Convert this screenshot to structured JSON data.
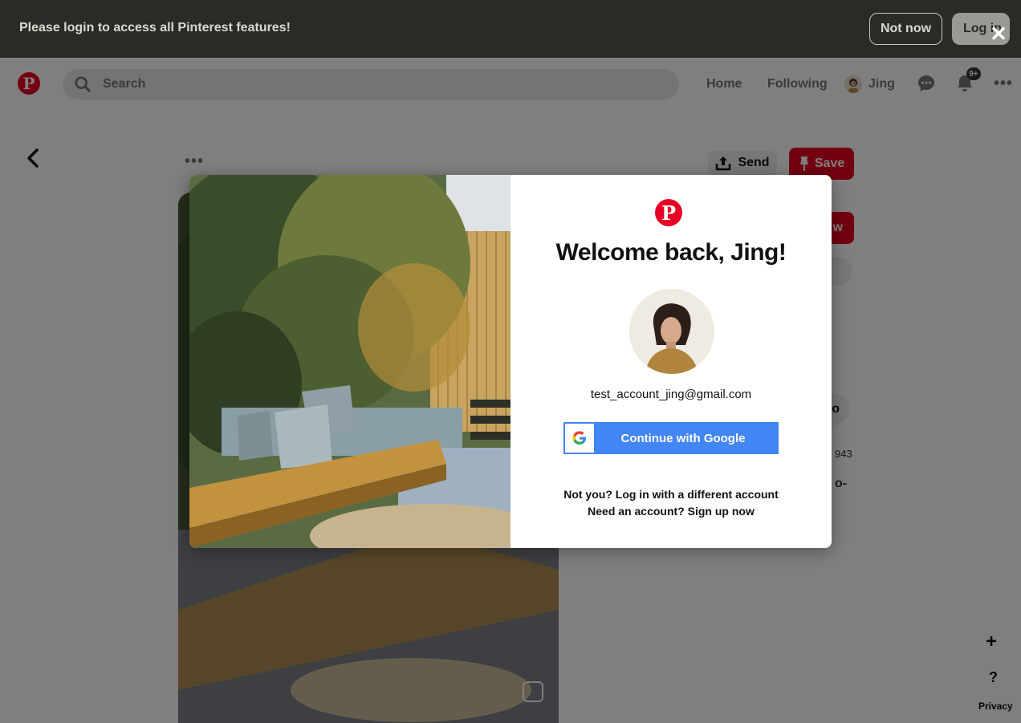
{
  "banner": {
    "message": "Please login to access all Pinterest features!",
    "not_now_label": "Not now",
    "login_label": "Log in",
    "close_glyph": "✕"
  },
  "header": {
    "logo_glyph": "P",
    "search_placeholder": "Search",
    "nav_home": "Home",
    "nav_following": "Following",
    "user_name": "Jing",
    "notification_badge": "9+",
    "more_glyph": "•••"
  },
  "pin": {
    "more_glyph": "•••",
    "send_label": "Send",
    "save_label": "Save",
    "follow_label": "w",
    "pill_label": "o",
    "count_partial": "943",
    "text_partial": "o-"
  },
  "floating": {
    "plus_glyph": "+",
    "help_glyph": "?",
    "privacy_label": "Privacy"
  },
  "modal": {
    "logo_glyph": "P",
    "title": "Welcome back, Jing!",
    "email": "test_account_jing@gmail.com",
    "google_button_label": "Continue with Google",
    "google_glyph": "G",
    "not_you_link": "Not you? Log in with a different account",
    "signup_link": "Need an account? Sign up now"
  },
  "colors": {
    "brand_red": "#e60023",
    "google_blue": "#4285f4",
    "banner_bg": "#2b2b26"
  }
}
